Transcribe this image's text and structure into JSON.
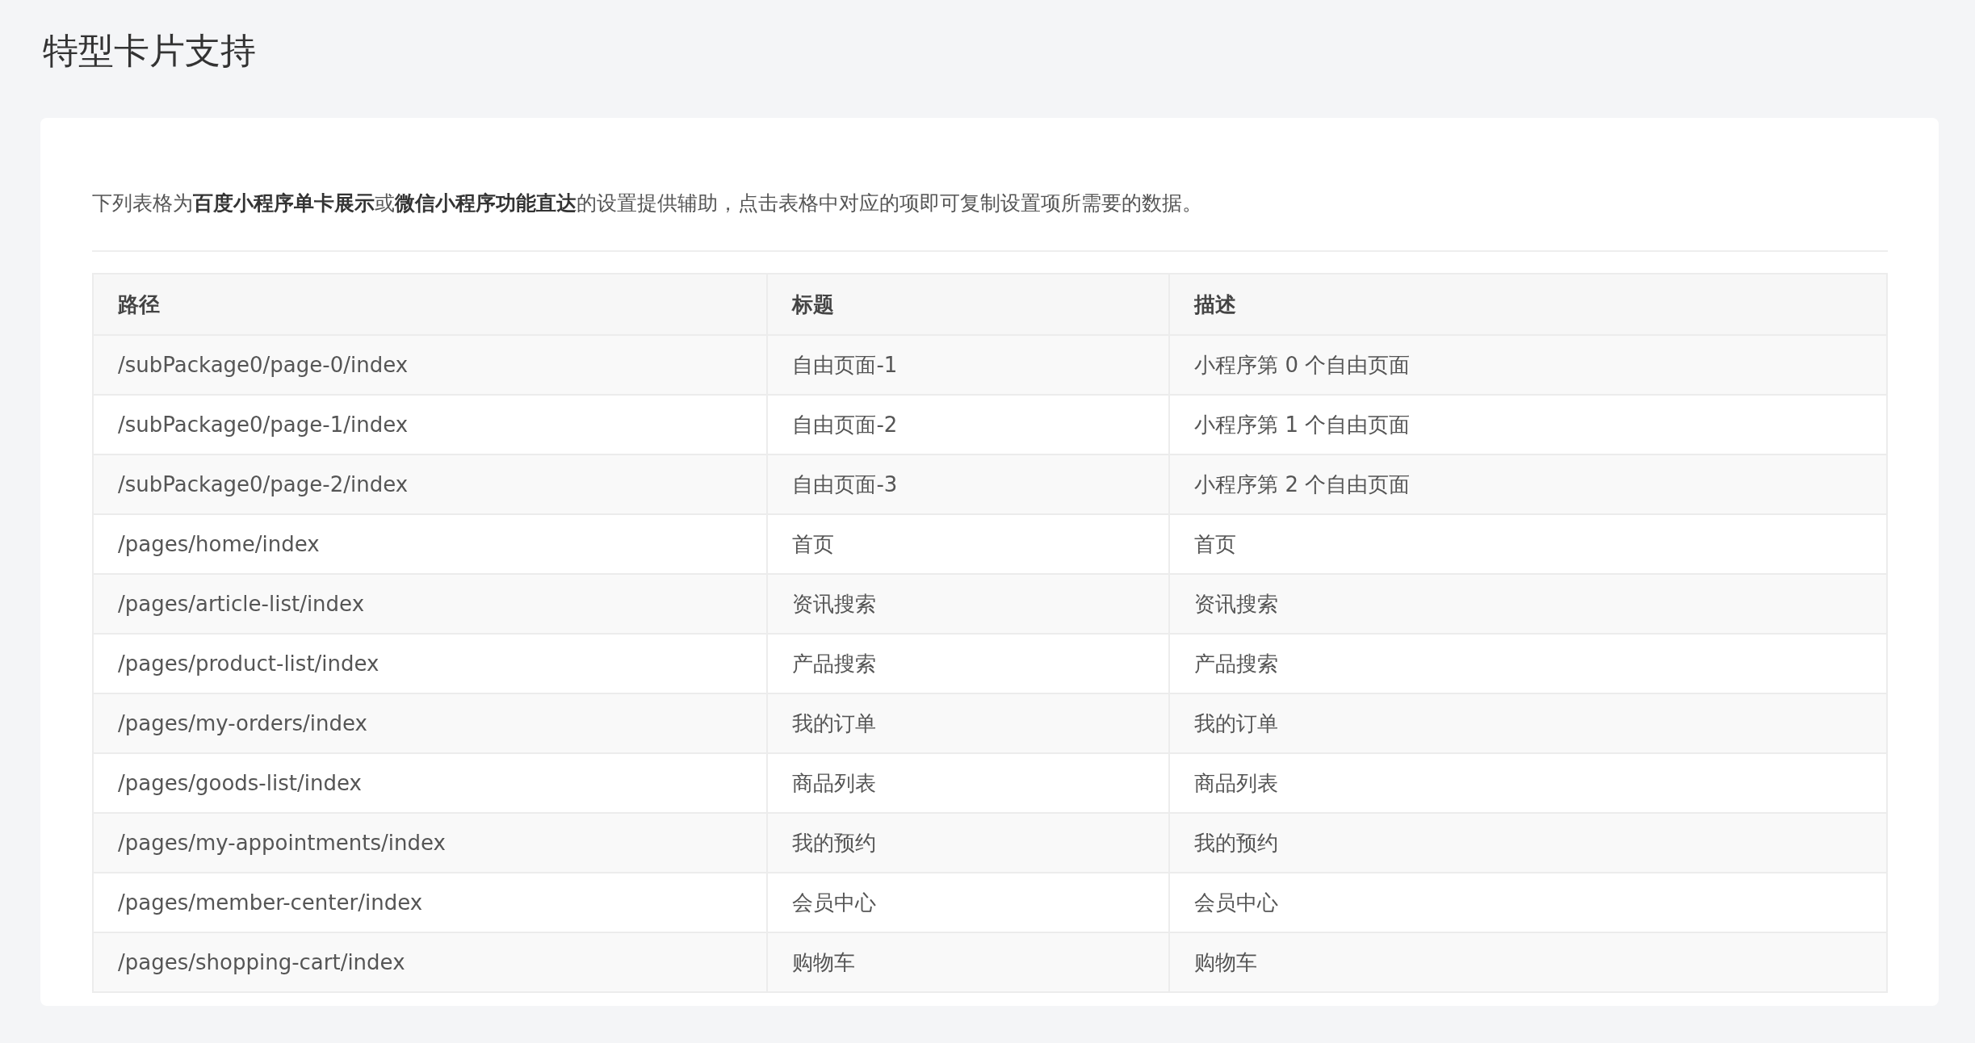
{
  "page_title": "特型卡片支持",
  "intro": "下列表格为**百度小程序单卡展示**或**微信小程序功能直达**的设置提供辅助，点击表格中对应的项即可复制设置项所需要的数据。",
  "table": {
    "columns": [
      "路径",
      "标题",
      "描述"
    ],
    "rows": [
      [
        "/subPackage0/page-0/index",
        "自由页面-1",
        "小程序第 0 个自由页面"
      ],
      [
        "/subPackage0/page-1/index",
        "自由页面-2",
        "小程序第 1 个自由页面"
      ],
      [
        "/subPackage0/page-2/index",
        "自由页面-3",
        "小程序第 2 个自由页面"
      ],
      [
        "/pages/home/index",
        "首页",
        "首页"
      ],
      [
        "/pages/article-list/index",
        "资讯搜索",
        "资讯搜索"
      ],
      [
        "/pages/product-list/index",
        "产品搜索",
        "产品搜索"
      ],
      [
        "/pages/my-orders/index",
        "我的订单",
        "我的订单"
      ],
      [
        "/pages/goods-list/index",
        "商品列表",
        "商品列表"
      ],
      [
        "/pages/my-appointments/index",
        "我的预约",
        "我的预约"
      ],
      [
        "/pages/member-center/index",
        "会员中心",
        "会员中心"
      ],
      [
        "/pages/shopping-cart/index",
        "购物车",
        "购物车"
      ]
    ]
  }
}
